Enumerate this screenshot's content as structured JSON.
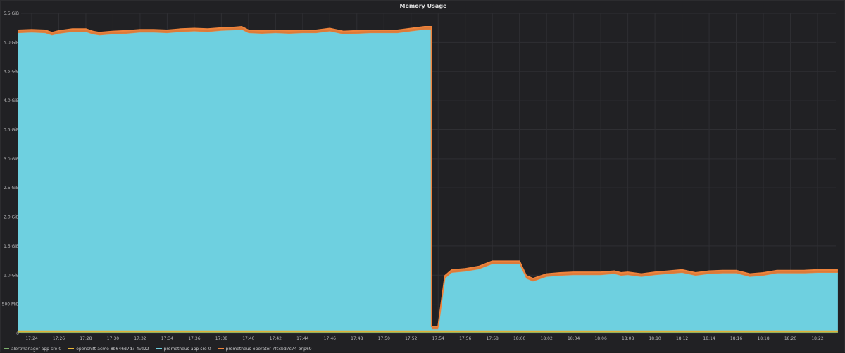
{
  "chart_data": {
    "type": "area",
    "title": "Memory Usage",
    "y_ticks": [
      "0",
      "500 MiB",
      "1.0 GiB",
      "1.5 GiB",
      "2.0 GiB",
      "2.5 GiB",
      "3.0 GiB",
      "3.5 GiB",
      "4.0 GiB",
      "4.5 GiB",
      "5.0 GiB",
      "5.5 GiB"
    ],
    "ylim": [
      0,
      5.5
    ],
    "y_unit": "GiB",
    "x_ticks": [
      "17:24",
      "17:26",
      "17:28",
      "17:30",
      "17:32",
      "17:34",
      "17:36",
      "17:38",
      "17:40",
      "17:42",
      "17:44",
      "17:46",
      "17:48",
      "17:50",
      "17:52",
      "17:54",
      "17:56",
      "17:58",
      "18:00",
      "18:02",
      "18:04",
      "18:06",
      "18:08",
      "18:10",
      "18:12",
      "18:14",
      "18:16",
      "18:18",
      "18:20",
      "18:22"
    ],
    "grid": true,
    "stacked": true,
    "legend_position": "bottom-left",
    "series": [
      {
        "name": "alertmanager-app-sre-0",
        "color": "#7eb26d",
        "x": [
          "17:23:00",
          "18:23:30"
        ],
        "y": [
          0.02,
          0.02
        ]
      },
      {
        "name": "openshift-acme-8b646d7d7-4vz22",
        "color": "#eab839",
        "x": [
          "17:23:00",
          "18:23:30"
        ],
        "y": [
          0.02,
          0.02
        ]
      },
      {
        "name": "prometheus-app-sre-0",
        "color": "#6ed0e0",
        "x": [
          "17:23:00",
          "17:24:00",
          "17:25:00",
          "17:25:30",
          "17:26:00",
          "17:27:00",
          "17:28:00",
          "17:28:30",
          "17:29:00",
          "17:30:00",
          "17:31:00",
          "17:32:00",
          "17:33:00",
          "17:34:00",
          "17:35:00",
          "17:36:00",
          "17:37:00",
          "17:38:00",
          "17:39:00",
          "17:39:30",
          "17:40:00",
          "17:41:00",
          "17:42:00",
          "17:43:00",
          "17:44:00",
          "17:45:00",
          "17:46:00",
          "17:47:00",
          "17:48:00",
          "17:49:00",
          "17:50:00",
          "17:51:00",
          "17:52:00",
          "17:53:00",
          "17:53:30",
          "17:53:31",
          "17:54:00",
          "17:54:30",
          "17:55:00",
          "17:56:00",
          "17:57:00",
          "17:58:00",
          "17:59:00",
          "18:00:00",
          "18:00:30",
          "18:01:00",
          "18:02:00",
          "18:03:00",
          "18:04:00",
          "18:05:00",
          "18:06:00",
          "18:07:00",
          "18:07:30",
          "18:08:00",
          "18:09:00",
          "18:10:00",
          "18:11:00",
          "18:12:00",
          "18:13:00",
          "18:14:00",
          "18:15:00",
          "18:16:00",
          "18:17:00",
          "18:18:00",
          "18:19:00",
          "18:20:00",
          "18:21:00",
          "18:22:00",
          "18:23:30"
        ],
        "y": [
          5.12,
          5.13,
          5.12,
          5.08,
          5.11,
          5.14,
          5.14,
          5.1,
          5.08,
          5.1,
          5.11,
          5.13,
          5.13,
          5.12,
          5.14,
          5.15,
          5.14,
          5.16,
          5.17,
          5.18,
          5.12,
          5.11,
          5.12,
          5.11,
          5.12,
          5.12,
          5.15,
          5.1,
          5.11,
          5.12,
          5.12,
          5.12,
          5.15,
          5.18,
          5.18,
          0.03,
          0.03,
          0.9,
          1.0,
          1.02,
          1.06,
          1.15,
          1.15,
          1.15,
          0.9,
          0.85,
          0.93,
          0.95,
          0.96,
          0.96,
          0.96,
          0.98,
          0.95,
          0.96,
          0.93,
          0.96,
          0.98,
          1.0,
          0.95,
          0.98,
          0.99,
          0.99,
          0.93,
          0.95,
          0.99,
          0.99,
          0.99,
          1.0,
          1.0
        ]
      },
      {
        "name": "prometheus-operator-7fccbd7c74-bnp69",
        "color": "#ef843c",
        "x": [
          "17:23:00",
          "18:23:30"
        ],
        "y": [
          0.05,
          0.05
        ]
      }
    ]
  }
}
